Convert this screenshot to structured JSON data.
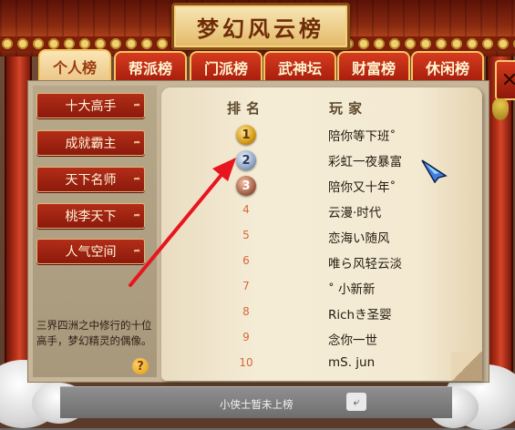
{
  "title": "梦幻风云榜",
  "tabs": [
    {
      "label": "个人榜",
      "active": true
    },
    {
      "label": "帮派榜",
      "active": false
    },
    {
      "label": "门派榜",
      "active": false
    },
    {
      "label": "武神坛",
      "active": false
    },
    {
      "label": "财富榜",
      "active": false
    },
    {
      "label": "休闲榜",
      "active": false
    }
  ],
  "side_menu": [
    "十大高手",
    "成就霸主",
    "天下名师",
    "桃李天下",
    "人气空间"
  ],
  "description": "三界四洲之中修行的十位高手，梦幻精灵的偶像。",
  "ranking": {
    "header_rank": "排名",
    "header_player": "玩家",
    "rows": [
      {
        "rank": "1",
        "name": "陪你等下班˚"
      },
      {
        "rank": "2",
        "name": "彩虹一夜暴富"
      },
      {
        "rank": "3",
        "name": "陪你又十年˚"
      },
      {
        "rank": "4",
        "name": "云漫·时代"
      },
      {
        "rank": "5",
        "name": "恋海い随风"
      },
      {
        "rank": "6",
        "name": "唯ら风轻云淡"
      },
      {
        "rank": "7",
        "name": "˚ 小新新"
      },
      {
        "rank": "8",
        "name": "Richき圣婴"
      },
      {
        "rank": "9",
        "name": "念你一世"
      },
      {
        "rank": "10",
        "name": "mS. jun"
      }
    ]
  },
  "status": "小侠士暂未上榜",
  "icons": {
    "close": "close-icon",
    "help": "help-icon",
    "share": "share-icon",
    "cursor": "cursor-icon"
  },
  "colors": {
    "tab_active_text": "#9a3a10",
    "rank_number": "#d6683a",
    "arrow": "#e8141e"
  }
}
